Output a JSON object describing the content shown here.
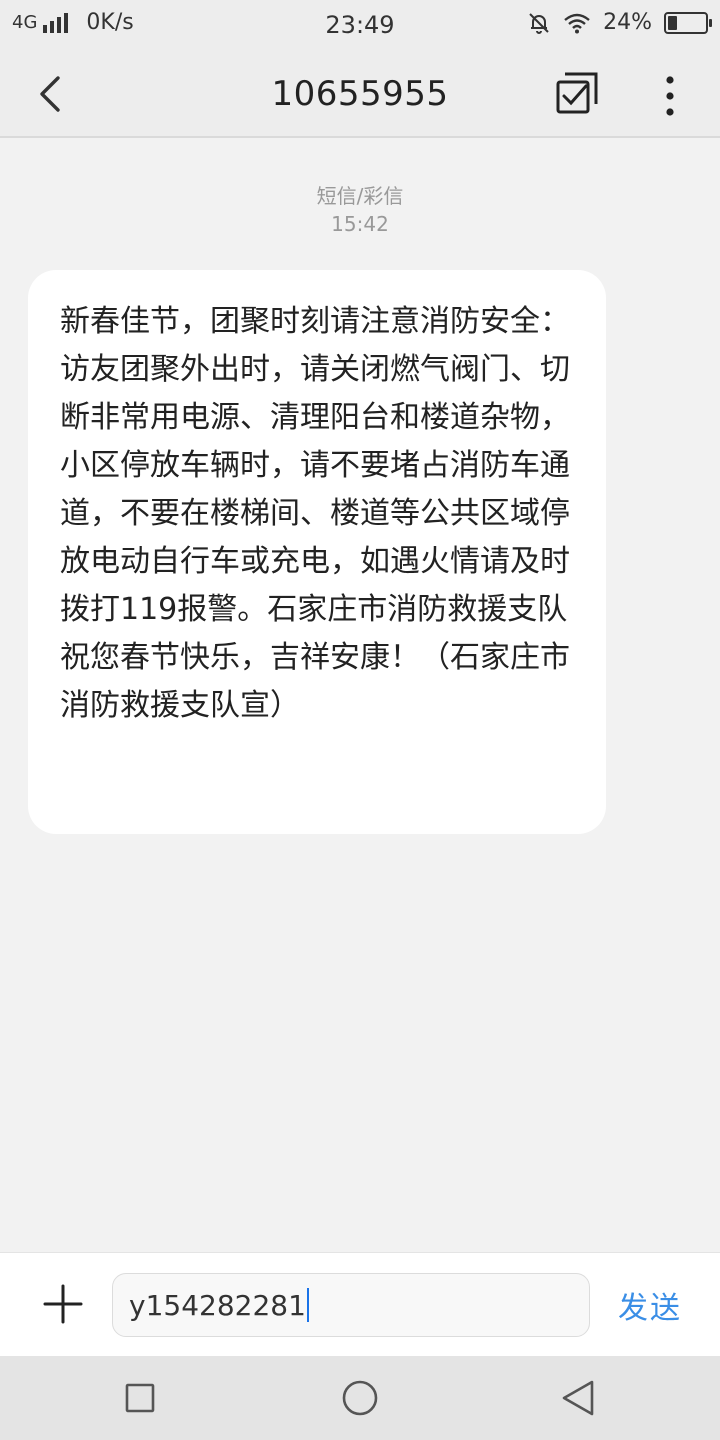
{
  "status_bar": {
    "network": "4G",
    "speed": "0K/s",
    "time": "23:49",
    "battery": "24%",
    "battery_level": 0.24
  },
  "header": {
    "title": "10655955"
  },
  "conversation": {
    "message_type": "短信/彩信",
    "timestamp": "15:42",
    "messages": [
      {
        "text": "新春佳节，团聚时刻请注意消防安全：访友团聚外出时，请关闭燃气阀门、切断非常用电源、清理阳台和楼道杂物，小区停放车辆时，请不要堵占消防车通道，不要在楼梯间、楼道等公共区域停放电动自行车或充电，如遇火情请及时拨打119报警。石家庄市消防救援支队祝您春节快乐，吉祥安康！（石家庄市消防救援支队宣）"
      }
    ]
  },
  "input_bar": {
    "value": "y154282281",
    "send_label": "发送"
  },
  "colors": {
    "accent": "#3a8ee6",
    "background": "#f2f2f2",
    "bubble": "#ffffff"
  }
}
